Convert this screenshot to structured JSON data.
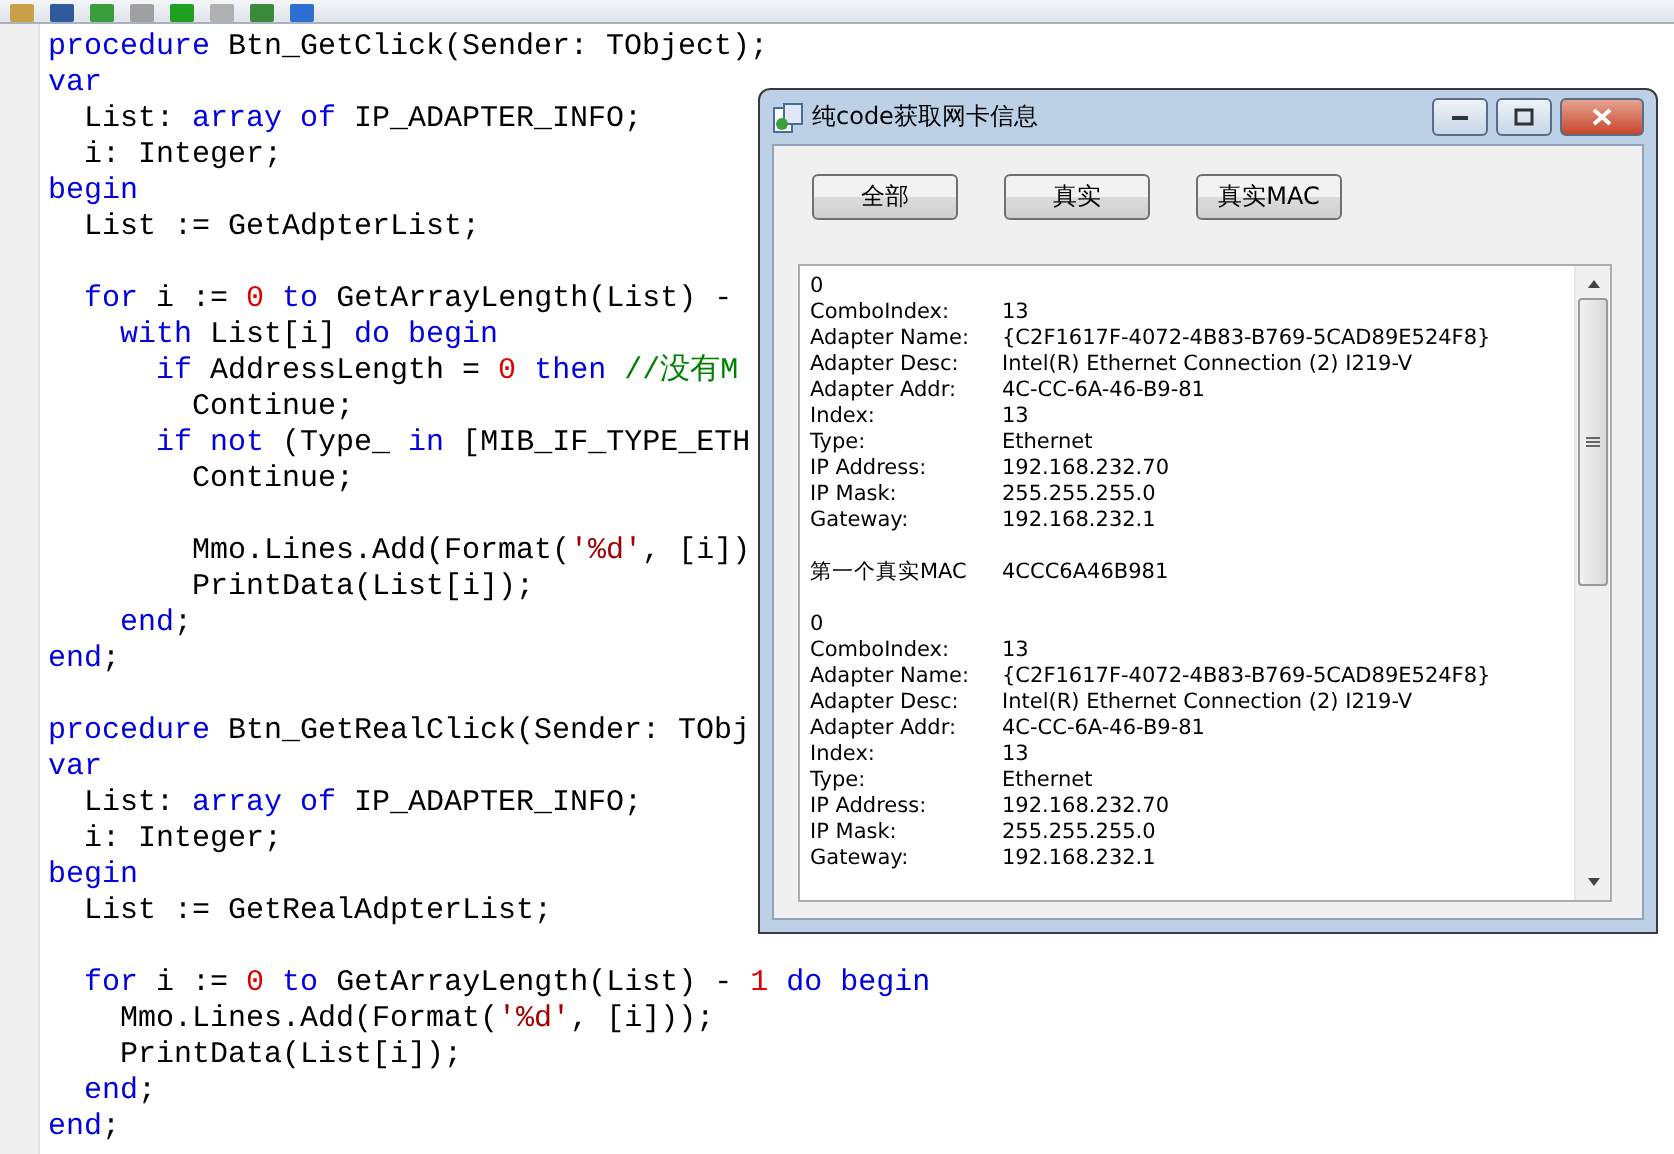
{
  "editor": {
    "lines": [
      {
        "kind": "code",
        "tokens": [
          {
            "kind": "kw",
            "t": "procedure"
          },
          {
            "kind": "id",
            "t": " Btn_GetClick(Sender: TObject);"
          }
        ]
      },
      {
        "kind": "code",
        "tokens": [
          {
            "kind": "kw",
            "t": "var"
          }
        ]
      },
      {
        "kind": "code",
        "tokens": [
          {
            "kind": "id",
            "t": "  List: "
          },
          {
            "kind": "kw",
            "t": "array of"
          },
          {
            "kind": "id",
            "t": " IP_ADAPTER_INFO;"
          }
        ]
      },
      {
        "kind": "code",
        "tokens": [
          {
            "kind": "id",
            "t": "  i: Integer;"
          }
        ]
      },
      {
        "kind": "code",
        "tokens": [
          {
            "kind": "kw",
            "t": "begin"
          }
        ]
      },
      {
        "kind": "code",
        "tokens": [
          {
            "kind": "id",
            "t": "  List := GetAdpterList;"
          }
        ]
      },
      {
        "kind": "blank"
      },
      {
        "kind": "code",
        "tokens": [
          {
            "kind": "kw",
            "t": "  for"
          },
          {
            "kind": "id",
            "t": " i := "
          },
          {
            "kind": "num",
            "t": "0"
          },
          {
            "kind": "kw",
            "t": " to"
          },
          {
            "kind": "id",
            "t": " GetArrayLength(List) -"
          }
        ]
      },
      {
        "kind": "code",
        "tokens": [
          {
            "kind": "kw",
            "t": "    with"
          },
          {
            "kind": "id",
            "t": " List[i] "
          },
          {
            "kind": "kw",
            "t": "do begin"
          }
        ]
      },
      {
        "kind": "code",
        "tokens": [
          {
            "kind": "kw",
            "t": "      if"
          },
          {
            "kind": "id",
            "t": " AddressLength = "
          },
          {
            "kind": "num",
            "t": "0"
          },
          {
            "kind": "kw",
            "t": " then"
          },
          {
            "kind": "cm",
            "t": " //没有M"
          }
        ]
      },
      {
        "kind": "code",
        "tokens": [
          {
            "kind": "id",
            "t": "        Continue;"
          }
        ]
      },
      {
        "kind": "code",
        "tokens": [
          {
            "kind": "kw",
            "t": "      if not"
          },
          {
            "kind": "id",
            "t": " (Type_ "
          },
          {
            "kind": "kw",
            "t": "in"
          },
          {
            "kind": "id",
            "t": " [MIB_IF_TYPE_ETH"
          }
        ]
      },
      {
        "kind": "code",
        "tokens": [
          {
            "kind": "id",
            "t": "        Continue;"
          }
        ]
      },
      {
        "kind": "blank"
      },
      {
        "kind": "code",
        "tokens": [
          {
            "kind": "id",
            "t": "        Mmo.Lines.Add(Format("
          },
          {
            "kind": "str",
            "t": "'%d'"
          },
          {
            "kind": "id",
            "t": ", [i])"
          }
        ]
      },
      {
        "kind": "code",
        "tokens": [
          {
            "kind": "id",
            "t": "        PrintData(List[i]);"
          }
        ]
      },
      {
        "kind": "code",
        "tokens": [
          {
            "kind": "kw",
            "t": "    end"
          },
          {
            "kind": "id",
            "t": ";"
          }
        ]
      },
      {
        "kind": "code",
        "tokens": [
          {
            "kind": "kw",
            "t": "end"
          },
          {
            "kind": "id",
            "t": ";"
          }
        ]
      },
      {
        "kind": "blank"
      },
      {
        "kind": "code",
        "tokens": [
          {
            "kind": "kw",
            "t": "procedure"
          },
          {
            "kind": "id",
            "t": " Btn_GetRealClick(Sender: TObj"
          }
        ]
      },
      {
        "kind": "code",
        "tokens": [
          {
            "kind": "kw",
            "t": "var"
          }
        ]
      },
      {
        "kind": "code",
        "tokens": [
          {
            "kind": "id",
            "t": "  List: "
          },
          {
            "kind": "kw",
            "t": "array of"
          },
          {
            "kind": "id",
            "t": " IP_ADAPTER_INFO;"
          }
        ]
      },
      {
        "kind": "code",
        "tokens": [
          {
            "kind": "id",
            "t": "  i: Integer;"
          }
        ]
      },
      {
        "kind": "code",
        "tokens": [
          {
            "kind": "kw",
            "t": "begin"
          }
        ]
      },
      {
        "kind": "code",
        "tokens": [
          {
            "kind": "id",
            "t": "  List := GetRealAdpterList;"
          }
        ]
      },
      {
        "kind": "blank"
      },
      {
        "kind": "code",
        "tokens": [
          {
            "kind": "kw",
            "t": "  for"
          },
          {
            "kind": "id",
            "t": " i := "
          },
          {
            "kind": "num",
            "t": "0"
          },
          {
            "kind": "kw",
            "t": " to"
          },
          {
            "kind": "id",
            "t": " GetArrayLength(List) - "
          },
          {
            "kind": "num",
            "t": "1"
          },
          {
            "kind": "kw",
            "t": " do begin"
          }
        ]
      },
      {
        "kind": "code",
        "tokens": [
          {
            "kind": "id",
            "t": "    Mmo.Lines.Add(Format("
          },
          {
            "kind": "str",
            "t": "'%d'"
          },
          {
            "kind": "id",
            "t": ", [i]));"
          }
        ]
      },
      {
        "kind": "code",
        "tokens": [
          {
            "kind": "id",
            "t": "    PrintData(List[i]);"
          }
        ]
      },
      {
        "kind": "code",
        "tokens": [
          {
            "kind": "kw",
            "t": "  end"
          },
          {
            "kind": "id",
            "t": ";"
          }
        ]
      },
      {
        "kind": "code",
        "tokens": [
          {
            "kind": "kw",
            "t": "end"
          },
          {
            "kind": "id",
            "t": ";"
          }
        ]
      }
    ]
  },
  "window": {
    "title": "纯code获取网卡信息",
    "buttons": [
      "全部",
      "真实",
      "真实MAC"
    ],
    "memo": [
      {
        "kind": "text",
        "label": "0"
      },
      {
        "kind": "pair",
        "label": "ComboIndex:",
        "value": "13"
      },
      {
        "kind": "pair",
        "label": "Adapter Name:",
        "value": "{C2F1617F-4072-4B83-B769-5CAD89E524F8}"
      },
      {
        "kind": "pair",
        "label": "Adapter Desc:",
        "value": "Intel(R) Ethernet Connection (2) I219-V"
      },
      {
        "kind": "pair",
        "label": "Adapter Addr:",
        "value": "4C-CC-6A-46-B9-81"
      },
      {
        "kind": "pair",
        "label": "Index:",
        "value": "13"
      },
      {
        "kind": "pair",
        "label": "Type:",
        "value": "Ethernet"
      },
      {
        "kind": "pair",
        "label": "IP Address:",
        "value": "192.168.232.70"
      },
      {
        "kind": "pair",
        "label": "IP Mask:",
        "value": "255.255.255.0"
      },
      {
        "kind": "pair",
        "label": "Gateway:",
        "value": "192.168.232.1"
      },
      {
        "kind": "gap"
      },
      {
        "kind": "pair",
        "label": "第一个真实MAC",
        "value": "4CCC6A46B981"
      },
      {
        "kind": "gap"
      },
      {
        "kind": "text",
        "label": "0"
      },
      {
        "kind": "pair",
        "label": "ComboIndex:",
        "value": "13"
      },
      {
        "kind": "pair",
        "label": "Adapter Name:",
        "value": "{C2F1617F-4072-4B83-B769-5CAD89E524F8}"
      },
      {
        "kind": "pair",
        "label": "Adapter Desc:",
        "value": "Intel(R) Ethernet Connection (2) I219-V"
      },
      {
        "kind": "pair",
        "label": "Adapter Addr:",
        "value": "4C-CC-6A-46-B9-81"
      },
      {
        "kind": "pair",
        "label": "Index:",
        "value": "13"
      },
      {
        "kind": "pair",
        "label": "Type:",
        "value": "Ethernet"
      },
      {
        "kind": "pair",
        "label": "IP Address:",
        "value": "192.168.232.70"
      },
      {
        "kind": "pair",
        "label": "IP Mask:",
        "value": "255.255.255.0"
      },
      {
        "kind": "pair",
        "label": "Gateway:",
        "value": "192.168.232.1"
      }
    ]
  }
}
